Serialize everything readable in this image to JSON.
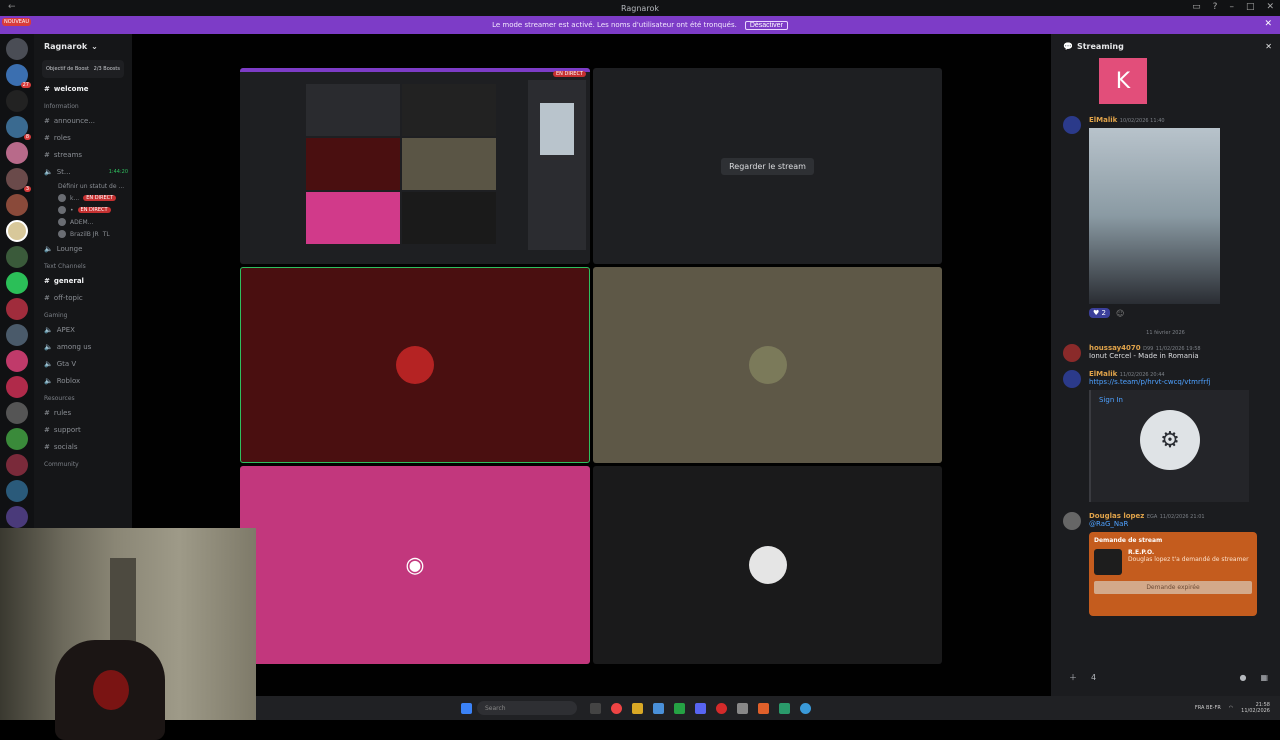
{
  "window": {
    "title": "Ragnarok"
  },
  "banner": {
    "text": "Le mode streamer est activé. Les noms d'utilisateur ont été tronqués.",
    "button": "Désactiver"
  },
  "rail": {
    "badge": "NOUVEAU"
  },
  "channels": {
    "server_name": "Ragnarok",
    "boost_label": "Objectif de Boost",
    "boost_count": "2/3 Boosts",
    "items": [
      {
        "type": "text",
        "name": "welcome",
        "active": true
      },
      {
        "type": "category",
        "name": "Information"
      },
      {
        "type": "text",
        "name": "announce..."
      },
      {
        "type": "text",
        "name": "roles"
      },
      {
        "type": "text",
        "name": "streams"
      },
      {
        "type": "voice",
        "name": "St...",
        "time": "1:44:20"
      },
      {
        "type": "status",
        "name": "Définir un statut de ..."
      },
      {
        "type": "voice-user",
        "name": "k...",
        "live": "EN DIRECT"
      },
      {
        "type": "voice-user",
        "name": "•",
        "live": "EN DIRECT"
      },
      {
        "type": "voice-user",
        "name": "ADEM..."
      },
      {
        "type": "voice-user",
        "name": "BrazilB JR",
        "tag": "TL"
      },
      {
        "type": "voice",
        "name": "Lounge"
      },
      {
        "type": "category",
        "name": "Text Channels"
      },
      {
        "type": "text",
        "name": "general",
        "active": true
      },
      {
        "type": "text",
        "name": "off-topic"
      },
      {
        "type": "category",
        "name": "Gaming"
      },
      {
        "type": "voice",
        "name": "APEX"
      },
      {
        "type": "voice",
        "name": "among us"
      },
      {
        "type": "voice",
        "name": "Gta V"
      },
      {
        "type": "voice",
        "name": "Roblox"
      },
      {
        "type": "category",
        "name": "Resources"
      },
      {
        "type": "text",
        "name": "rules"
      },
      {
        "type": "text",
        "name": "support"
      },
      {
        "type": "text",
        "name": "socials"
      },
      {
        "type": "category",
        "name": "Community"
      }
    ]
  },
  "stage": {
    "preview_live": "EN DIRECT",
    "watch_button": "Regarder le stream"
  },
  "side": {
    "title": "Streaming",
    "k_letter": "K",
    "messages": [
      {
        "author": "ElMalik",
        "time": "10/02/2026 11:40",
        "reaction": "2"
      },
      {
        "divider": "11 février 2026"
      },
      {
        "author": "houssay4070",
        "tag": "D99",
        "time": "11/02/2026 19:58",
        "text": "Ionut Cercel - Made in Romania"
      },
      {
        "author": "ElMalik",
        "time": "11/02/2026 20:44",
        "link": "https://s.team/p/hrvt-cwcq/vtmrfrfj",
        "embed_title": "Sign In"
      },
      {
        "author": "Douglas lopez",
        "tag": "EGA",
        "time": "11/02/2026 21:01",
        "mention": "@RaG_NaR"
      }
    ],
    "request": {
      "title": "Demande de stream",
      "game": "R.E.P.O.",
      "text": "Douglas lopez t'a demandé de streamer",
      "button": "Demande expirée"
    }
  },
  "composer": {
    "count": "4"
  },
  "taskbar": {
    "search": "Search",
    "lang": "FRA BE-FR",
    "time": "21:58",
    "date": "11/02/2026"
  }
}
